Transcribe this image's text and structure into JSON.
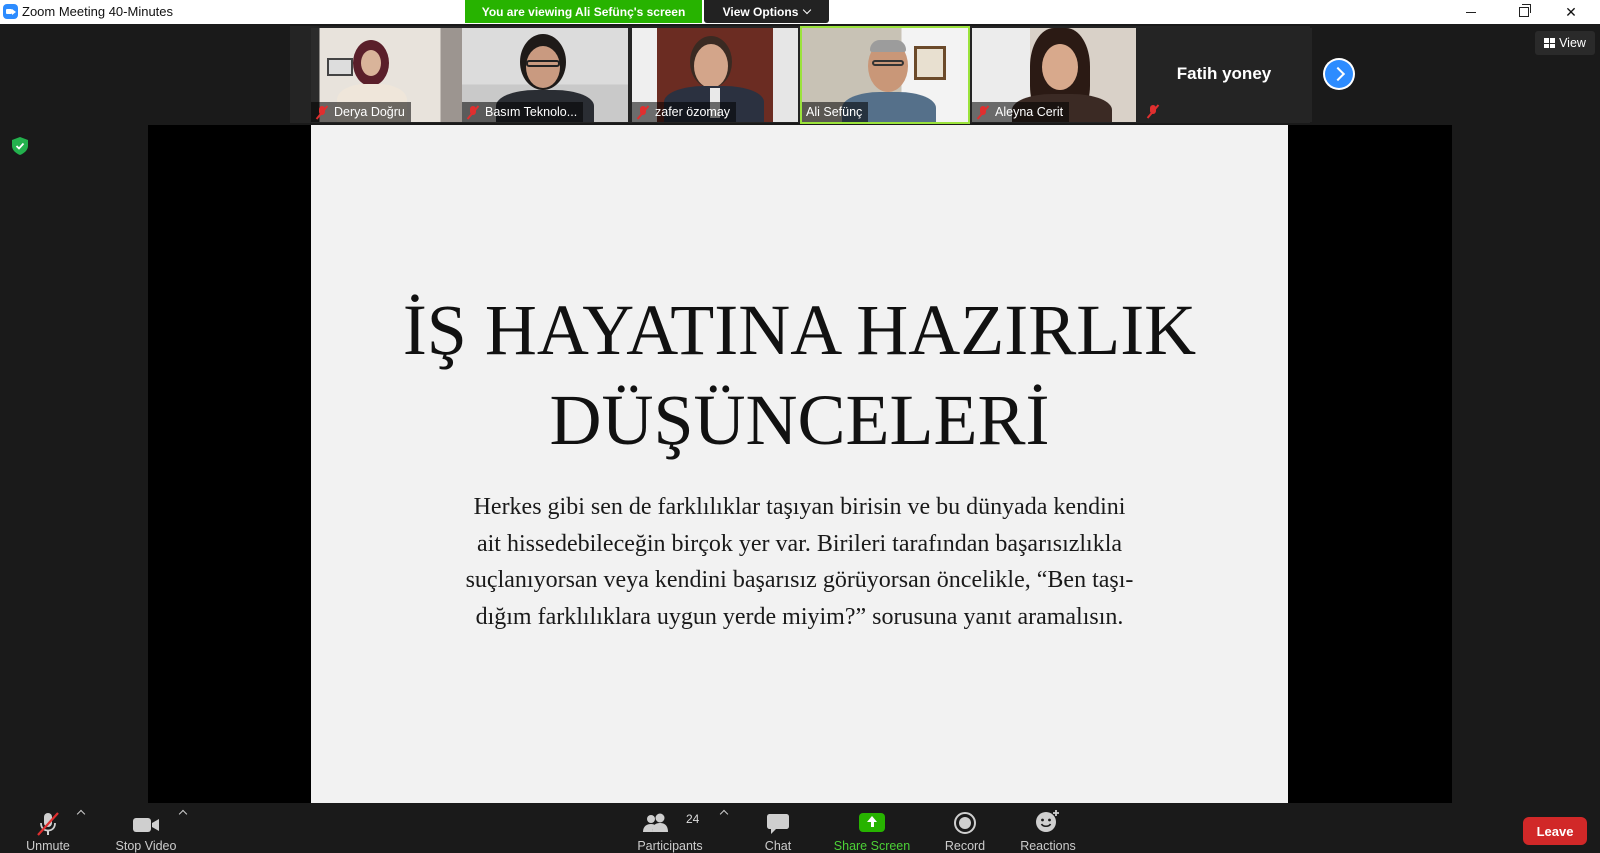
{
  "window": {
    "title": "Zoom Meeting 40-Minutes",
    "minimize": "─",
    "maximize": "❐",
    "close": "✕"
  },
  "banner": {
    "viewing_text": "You are viewing Ali Sefünç's screen",
    "view_options_label": "View Options"
  },
  "gallery": {
    "participants": [
      {
        "name": "Derya Doğru"
      },
      {
        "name": "Basım Teknolo..."
      },
      {
        "name": "zafer özomay"
      },
      {
        "name": "Ali Sefünç"
      },
      {
        "name": "Aleyna Cerit"
      }
    ],
    "name_only_tile": "Fatih yoney",
    "view_label": "View"
  },
  "slide": {
    "title_line1": "İŞ HAYATINA HAZIRLIK",
    "title_line2": "DÜŞÜNCELERİ",
    "body_line1": "Herkes gibi sen de farklılıklar taşıyan birisin ve bu dünyada kendini",
    "body_line2": "ait hissedebileceğin birçok yer var. Birileri tarafından başarısızlıkla",
    "body_line3": "suçlanıyorsan veya kendini başarısız görüyorsan öncelikle, “Ben taşı-",
    "body_line4": "dığım farklılıklara uygun yerde miyim?” sorusuna yanıt aramalısın."
  },
  "toolbar": {
    "unmute": "Unmute",
    "stop_video": "Stop Video",
    "participants": "Participants",
    "participants_count": "24",
    "chat": "Chat",
    "share_screen": "Share Screen",
    "record": "Record",
    "reactions": "Reactions",
    "leave": "Leave"
  },
  "colors": {
    "share_green": "#27b300",
    "leave_red": "#d12828",
    "accent_blue": "#2d8cff",
    "active_speaker": "#9be33b",
    "muted_red": "#e02f2f"
  }
}
